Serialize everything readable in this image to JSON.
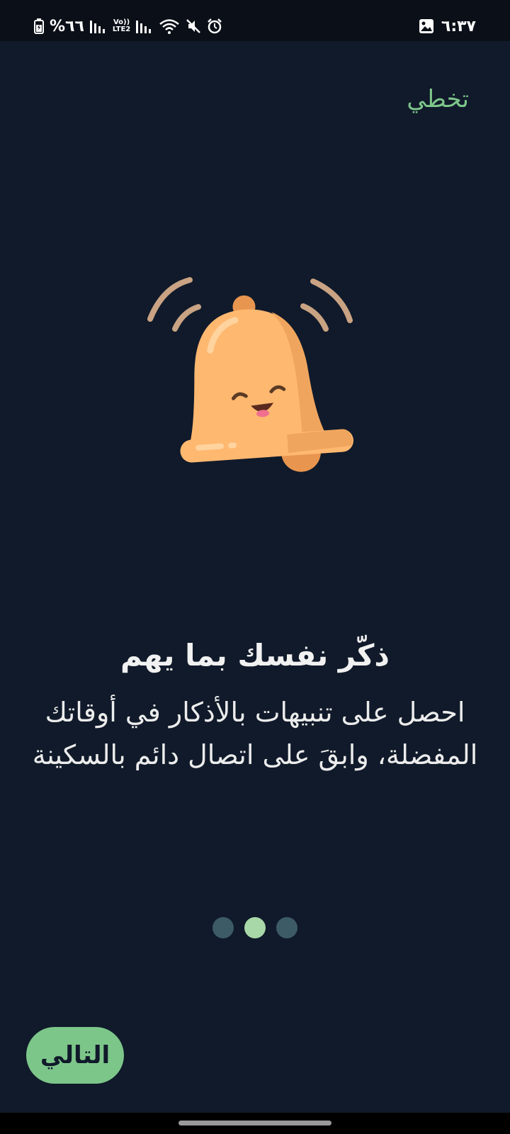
{
  "status_bar": {
    "battery_text": "%٦٦",
    "network_label_top": "Vo))",
    "network_label_bottom": "LTE2",
    "time": "٦:٣٧"
  },
  "header": {
    "skip_label": "تخطي"
  },
  "illustration": {
    "icon": "happy-bell-icon",
    "colors": {
      "bell": "#ffb870",
      "bell_shade": "#e8954f",
      "waves": "#c9a383"
    }
  },
  "content": {
    "title": "ذكّر نفسك بما يهم",
    "description": "احصل على تنبيهات بالأذكار في أوقاتك المفضلة، وابقَ على اتصال دائم بالسكينة"
  },
  "pager": {
    "total": 3,
    "active_index": 1
  },
  "footer": {
    "next_label": "التالي"
  },
  "colors": {
    "background": "#101a2a",
    "accent": "#7dc68a",
    "dot_inactive": "#3d5b66",
    "dot_active": "#a8d8a8"
  }
}
